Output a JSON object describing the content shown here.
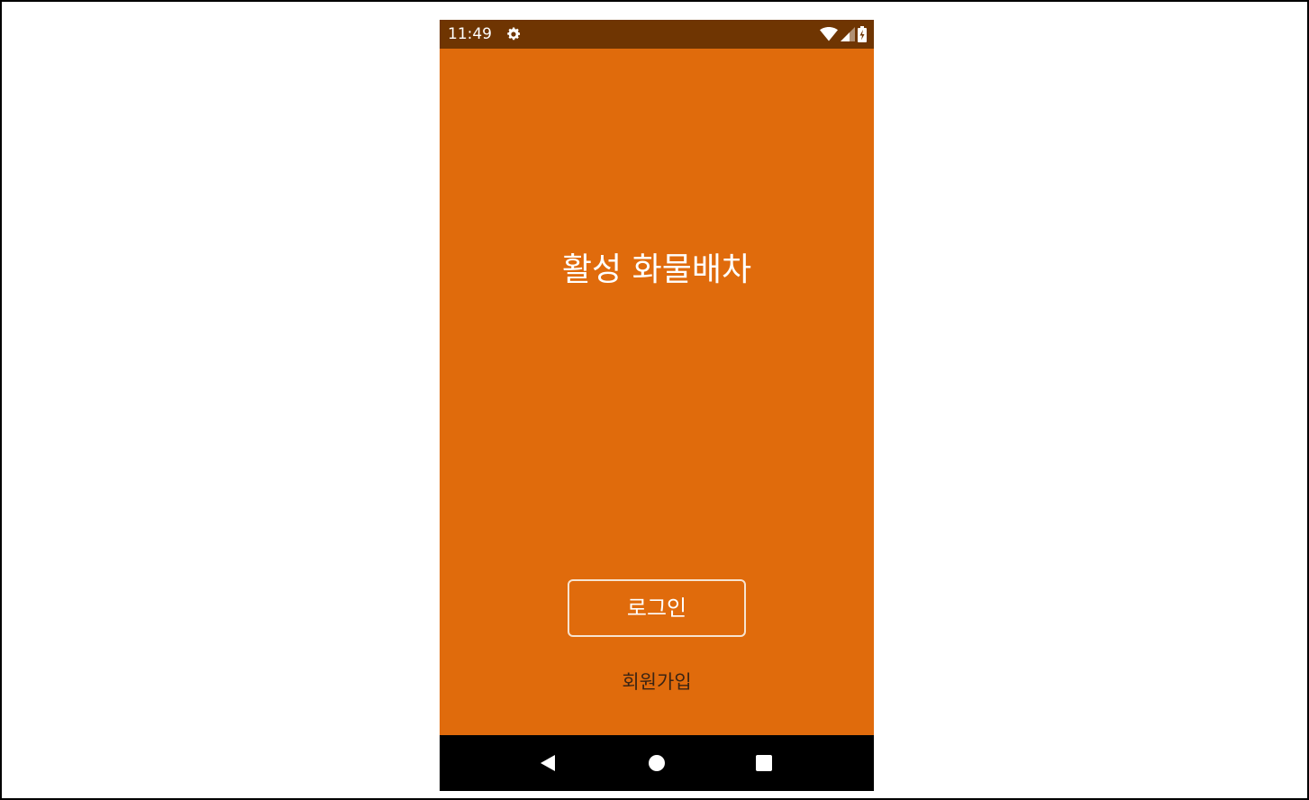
{
  "status_bar": {
    "time": "11:49",
    "left_icons": [
      "gear-icon"
    ],
    "right_icons": [
      "wifi-icon",
      "signal-icon",
      "battery-charging-icon"
    ],
    "background_color": "#6f3502"
  },
  "app": {
    "title": "활성 화물배차",
    "background_color": "#e06b0c"
  },
  "login": {
    "label": "로그인"
  },
  "signup": {
    "label": "회원가입"
  },
  "nav_bar": {
    "icons": [
      "back-icon",
      "home-icon",
      "recents-icon"
    ],
    "background_color": "#000000"
  }
}
